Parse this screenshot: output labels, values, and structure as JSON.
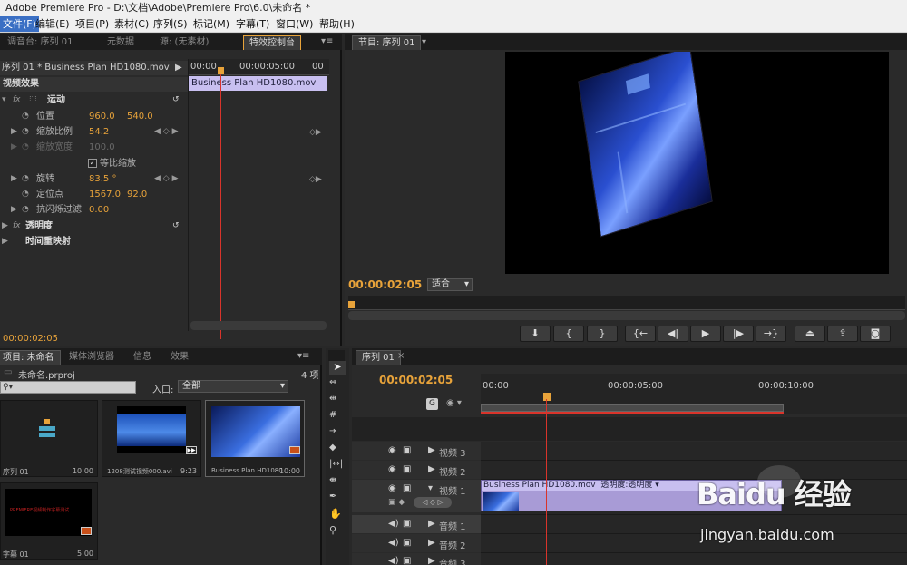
{
  "title": "Adobe Premiere Pro - D:\\文档\\Adobe\\Premiere Pro\\6.0\\未命名 *",
  "menu": [
    "文件(F)",
    "编辑(E)",
    "项目(P)",
    "素材(C)",
    "序列(S)",
    "标记(M)",
    "字幕(T)",
    "窗口(W)",
    "帮助(H)"
  ],
  "effects_panel": {
    "tabs": [
      "调音台: 序列 01",
      "元数据",
      "源: (无素材)",
      "特效控制台"
    ],
    "clip_title": "序列 01 * Business Plan HD1080.mov",
    "ruler": [
      "00:00",
      "00:00:05:00",
      "00"
    ],
    "clip_bar": "Business Plan HD1080.mov",
    "section": "视频效果",
    "motion": "运动",
    "props": [
      {
        "name": "位置",
        "v1": "960.0",
        "v2": "540.0"
      },
      {
        "name": "缩放比例",
        "v1": "54.2",
        "v2": ""
      },
      {
        "name": "缩放宽度",
        "v1": "100.0",
        "v2": ""
      },
      {
        "name": "等比缩放",
        "v1": "",
        "v2": ""
      },
      {
        "name": "旋转",
        "v1": "83.5 °",
        "v2": ""
      },
      {
        "name": "定位点",
        "v1": "1567.0",
        "v2": "92.0"
      },
      {
        "name": "抗闪烁过滤",
        "v1": "0.00",
        "v2": ""
      }
    ],
    "opacity": "透明度",
    "timeremap": "时间重映射",
    "timecode": "00:00:02:05"
  },
  "program": {
    "tab": "节目: 序列 01",
    "timecode": "00:00:02:05",
    "fit": "适合"
  },
  "project": {
    "tabs": [
      "项目: 未命名",
      "媒体浏览器",
      "信息",
      "效果"
    ],
    "filename": "未命名.prproj",
    "count": "4 项",
    "in_label": "入口:",
    "in_value": "全部",
    "items": [
      {
        "name": "序列 01",
        "dur": "10:00"
      },
      {
        "name": "1208测试视频000.avi",
        "dur": "9:23"
      },
      {
        "name": "Business Plan HD1080...",
        "dur": "10:00"
      },
      {
        "name": "字幕 01",
        "dur": "5:00",
        "text": "PREMIERE视频制作字幕测试"
      }
    ]
  },
  "timeline": {
    "tab": "序列 01",
    "timecode": "00:00:02:05",
    "ruler": [
      "00:00",
      "00:00:05:00",
      "00:00:10:00"
    ],
    "tracks": [
      "视频 3",
      "视频 2",
      "视频 1",
      "音频 1",
      "音频 2",
      "音频 3"
    ],
    "clip": "Business Plan HD1080.mov",
    "clip_fx": "透明度:透明度 ▾"
  },
  "watermark": {
    "text": "Baidu 经验",
    "url": "jingyan.baidu.com"
  },
  "colors": {
    "accent": "#e8a33a",
    "clip": "#a89bd6",
    "clip_header": "#c8bff0",
    "playhead": "#d9342b"
  },
  "icons": [
    "eye-icon",
    "film-icon",
    "speaker-icon",
    "stopwatch-icon",
    "reset-icon",
    "selection-tool-icon",
    "hand-tool-icon",
    "zoom-tool-icon",
    "razor-tool-icon",
    "camera-icon",
    "play-icon"
  ]
}
